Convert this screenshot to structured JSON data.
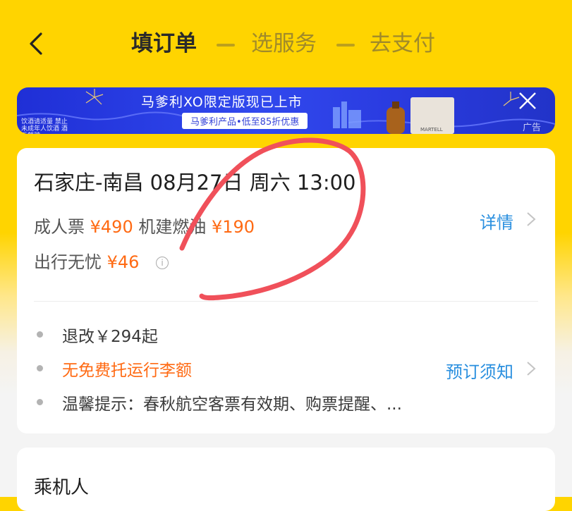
{
  "header": {
    "steps": [
      "填订单",
      "选服务",
      "去支付"
    ]
  },
  "banner": {
    "title": "马爹利XO限定版现已上市",
    "promo": "马爹利产品•低至85折优惠",
    "small_text": "饮酒请适量 禁止未成年人饮酒 酒后驾驶",
    "ad_label": "广告",
    "product_brand": "MARTELL"
  },
  "flight": {
    "route": "石家庄-南昌 08月27日 周六 13:00",
    "adult_label": "成人票",
    "adult_price": "¥490",
    "tax_label": "机建燃油",
    "tax_price": "¥190",
    "insurance_label": "出行无忧",
    "insurance_price": "¥46",
    "detail_link": "详情",
    "refund_text": "退改￥294起",
    "baggage_text": "无免费托运行李额",
    "notice_link": "预订须知",
    "tip_text": "温馨提示：春秋航空客票有效期、购票提醒、..."
  },
  "passenger": {
    "title": "乘机人"
  },
  "colors": {
    "accent_yellow": "#FFD400",
    "price_orange": "#FF6A13",
    "link_blue": "#2A8FDF",
    "banner_blue": "#3149EE",
    "annotation_red": "#F0505A"
  }
}
